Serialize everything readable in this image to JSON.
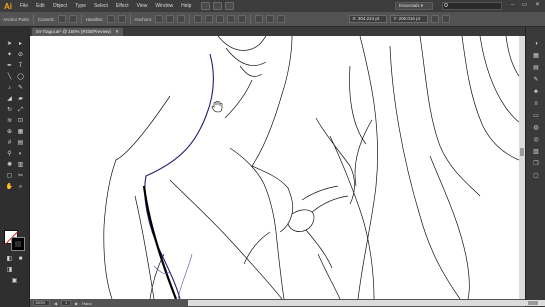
{
  "app": {
    "logo": "Ai"
  },
  "menu": [
    "File",
    "Edit",
    "Object",
    "Type",
    "Select",
    "Effect",
    "View",
    "Window",
    "Help"
  ],
  "workspace": {
    "label": "Essentials ▾"
  },
  "search": {
    "placeholder": ""
  },
  "window_controls": {
    "minimize": "–",
    "maximize": "▭",
    "close": "✕"
  },
  "control_bar": {
    "selection_label": "Anchor Point",
    "convert_label": "Convert:",
    "handles_label": "Handles:",
    "anchors_label": "Anchors:",
    "x_value": "X: 304.224 pt",
    "y_value": "Y: 200.016 pt"
  },
  "document": {
    "tab": "04-Tiagui.ai* @ 150% (RGB/Preview)",
    "close": "✕"
  },
  "status": {
    "zoom": "150%",
    "artboard": "1",
    "tool": "Hand"
  },
  "icons": {
    "selection": "selection-arrow-icon",
    "direct": "direct-selection-icon",
    "pen": "pen-icon",
    "type": "type-icon",
    "hand": "hand-icon",
    "zoom": "zoom-icon"
  },
  "colors": {
    "accent": "#f7a21b",
    "path_highlight": "#2a1a6e",
    "canvas": "#ffffff"
  }
}
